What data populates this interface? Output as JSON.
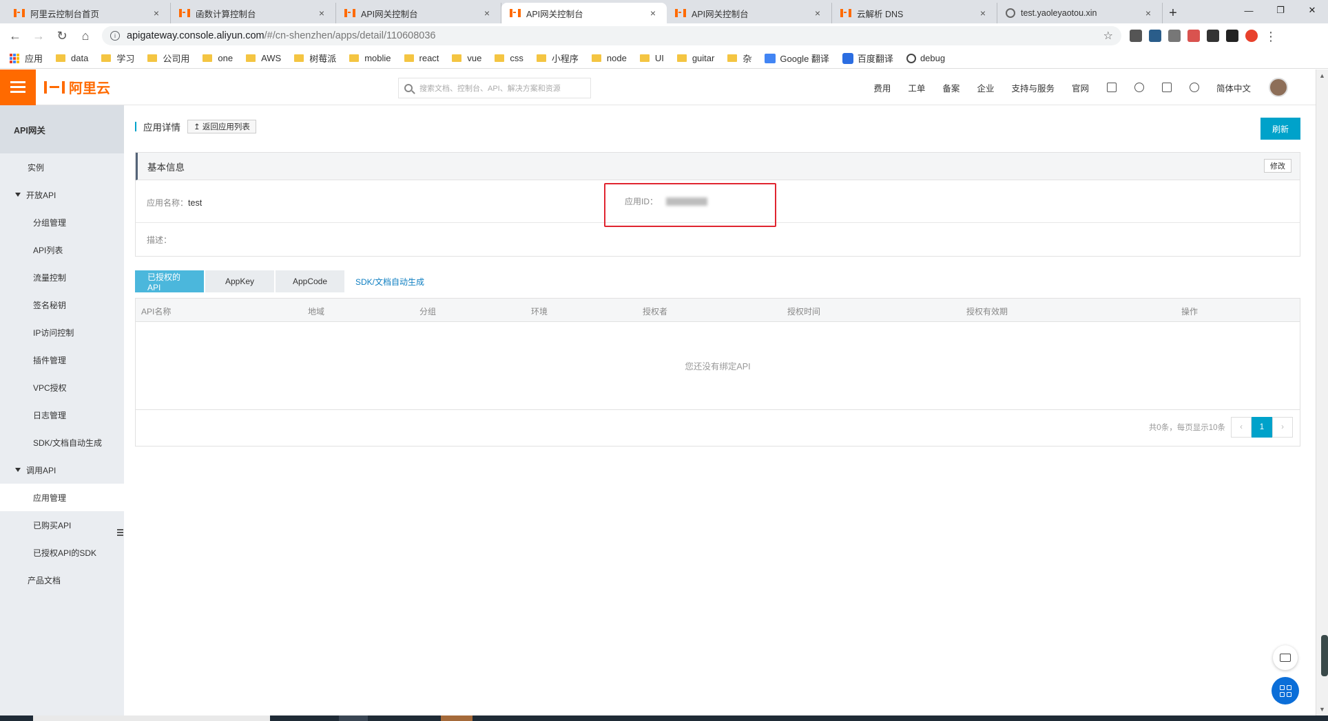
{
  "browser": {
    "tabs": [
      {
        "title": "阿里云控制台首页",
        "fav": "aliyun"
      },
      {
        "title": "函数计算控制台",
        "fav": "aliyun"
      },
      {
        "title": "API网关控制台",
        "fav": "aliyun"
      },
      {
        "title": "API网关控制台",
        "fav": "aliyun",
        "active": true
      },
      {
        "title": "API网关控制台",
        "fav": "aliyun"
      },
      {
        "title": "云解析 DNS",
        "fav": "aliyun"
      },
      {
        "title": "test.yaoleyaotou.xin",
        "fav": "globe"
      }
    ],
    "close_glyph": "×",
    "newtab_glyph": "+",
    "win_min": "—",
    "win_max": "❐",
    "win_close": "✕",
    "url_host": "apigateway.console.aliyun.com",
    "url_path": "/#/cn-shenzhen/apps/detail/110608036",
    "bookmarks": [
      {
        "label": "应用",
        "type": "apps"
      },
      {
        "label": "data",
        "type": "folder"
      },
      {
        "label": "学习",
        "type": "folder"
      },
      {
        "label": "公司用",
        "type": "folder"
      },
      {
        "label": "one",
        "type": "folder"
      },
      {
        "label": "AWS",
        "type": "folder"
      },
      {
        "label": "树莓派",
        "type": "folder"
      },
      {
        "label": "moblie",
        "type": "folder"
      },
      {
        "label": "react",
        "type": "folder"
      },
      {
        "label": "vue",
        "type": "folder"
      },
      {
        "label": "css",
        "type": "folder"
      },
      {
        "label": "小程序",
        "type": "folder"
      },
      {
        "label": "node",
        "type": "folder"
      },
      {
        "label": "UI",
        "type": "folder"
      },
      {
        "label": "guitar",
        "type": "folder"
      },
      {
        "label": "杂",
        "type": "folder"
      },
      {
        "label": "Google 翻译",
        "type": "gtrans"
      },
      {
        "label": "百度翻译",
        "type": "btrans"
      },
      {
        "label": "debug",
        "type": "globe"
      }
    ]
  },
  "topbar": {
    "logo_text": "阿里云",
    "search_placeholder": "搜索文档、控制台、API、解决方案和资源",
    "nav": [
      "费用",
      "工单",
      "备案",
      "企业",
      "支持与服务",
      "官网"
    ],
    "lang": "简体中文",
    "icons": [
      "terminal-icon",
      "bell-icon",
      "cart-icon",
      "help-icon"
    ]
  },
  "sidebar": {
    "title": "API网关",
    "items": [
      {
        "label": "实例",
        "level": "l1"
      },
      {
        "label": "开放API",
        "level": "grp"
      },
      {
        "label": "分组管理",
        "level": "l2"
      },
      {
        "label": "API列表",
        "level": "l2"
      },
      {
        "label": "流量控制",
        "level": "l2"
      },
      {
        "label": "签名秘钥",
        "level": "l2"
      },
      {
        "label": "IP访问控制",
        "level": "l2"
      },
      {
        "label": "插件管理",
        "level": "l2"
      },
      {
        "label": "VPC授权",
        "level": "l2"
      },
      {
        "label": "日志管理",
        "level": "l2"
      },
      {
        "label": "SDK/文档自动生成",
        "level": "l2"
      },
      {
        "label": "调用API",
        "level": "grp"
      },
      {
        "label": "应用管理",
        "level": "l2",
        "active": true
      },
      {
        "label": "已购买API",
        "level": "l2"
      },
      {
        "label": "已授权API的SDK",
        "level": "l2"
      },
      {
        "label": "产品文档",
        "level": "l1"
      }
    ]
  },
  "page": {
    "title": "应用详情",
    "back_label": "↥ 返回应用列表",
    "refresh_label": "刷新",
    "basic": {
      "header": "基本信息",
      "edit_label": "修改",
      "name_label": "应用名称：",
      "name_value": "test",
      "id_label": "应用ID：",
      "desc_label": "描述："
    },
    "tabs": [
      "已授权的API",
      "AppKey",
      "AppCode"
    ],
    "tab_link": "SDK/文档自动生成",
    "table": {
      "columns": [
        "API名称",
        "地域",
        "分组",
        "环境",
        "授权者",
        "授权时间",
        "授权有效期",
        "操作"
      ],
      "empty": "您还没有绑定API"
    },
    "pager": {
      "summary": "共0条，每页显示10条",
      "prev": "‹",
      "current": "1",
      "next": "›"
    }
  },
  "colors": {
    "brand": "#ff6a00",
    "primary": "#00a2ca",
    "highlight_box": "#e0242f"
  }
}
